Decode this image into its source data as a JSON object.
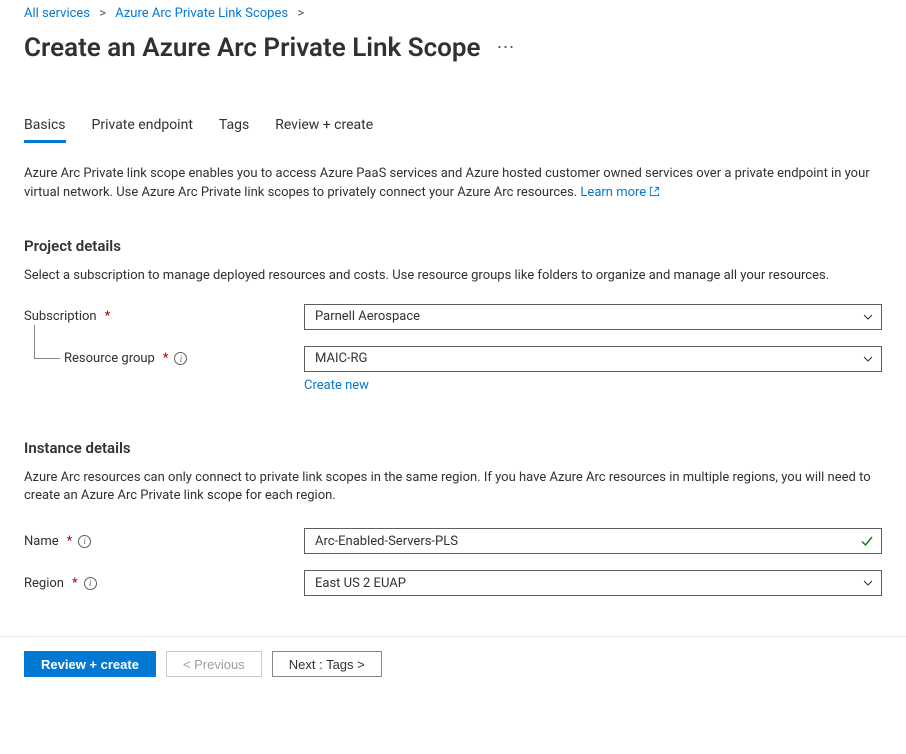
{
  "breadcrumb": {
    "items": [
      {
        "label": "All services"
      },
      {
        "label": "Azure Arc Private Link Scopes"
      }
    ]
  },
  "header": {
    "title": "Create an Azure Arc Private Link Scope"
  },
  "tabs": [
    {
      "label": "Basics",
      "active": true
    },
    {
      "label": "Private endpoint",
      "active": false
    },
    {
      "label": "Tags",
      "active": false
    },
    {
      "label": "Review + create",
      "active": false
    }
  ],
  "intro": {
    "text": "Azure Arc Private link scope enables you to access Azure PaaS services and Azure hosted customer owned services over a private endpoint in your virtual network. Use Azure Arc Private link scopes to privately connect your Azure Arc resources. ",
    "learn_more": "Learn more"
  },
  "project_details": {
    "heading": "Project details",
    "description": "Select a subscription to manage deployed resources and costs. Use resource groups like folders to organize and manage all your resources.",
    "subscription_label": "Subscription",
    "subscription_value": "Parnell Aerospace",
    "resource_group_label": "Resource group",
    "resource_group_value": "MAIC-RG",
    "create_new": "Create new"
  },
  "instance_details": {
    "heading": "Instance details",
    "description": "Azure Arc resources can only connect to private link scopes in the same region. If you have Azure Arc resources in multiple regions, you will need to create an Azure Arc Private link scope for each region.",
    "name_label": "Name",
    "name_value": "Arc-Enabled-Servers-PLS",
    "region_label": "Region",
    "region_value": "East US 2 EUAP"
  },
  "footer": {
    "review_create": "Review + create",
    "previous": "< Previous",
    "next": "Next : Tags >"
  }
}
